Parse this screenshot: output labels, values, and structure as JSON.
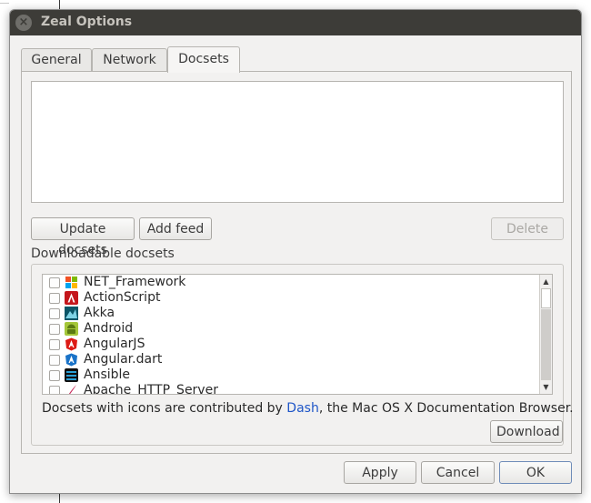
{
  "window": {
    "title": "Zeal Options",
    "close_glyph": "×"
  },
  "tabs": [
    {
      "label": "General",
      "active": false
    },
    {
      "label": "Network",
      "active": false
    },
    {
      "label": "Docsets",
      "active": true
    }
  ],
  "buttons": {
    "update": "Update docsets",
    "add_feed": "Add feed",
    "delete": "Delete",
    "download": "Download",
    "apply": "Apply",
    "cancel": "Cancel",
    "ok": "OK"
  },
  "downloadable": {
    "heading": "Downloadable docsets",
    "items": [
      {
        "label": "NET_Framework",
        "checked": false,
        "icon": "dotnet-icon"
      },
      {
        "label": "ActionScript",
        "checked": false,
        "icon": "actionscript-icon"
      },
      {
        "label": "Akka",
        "checked": false,
        "icon": "akka-icon"
      },
      {
        "label": "Android",
        "checked": false,
        "icon": "android-icon"
      },
      {
        "label": "AngularJS",
        "checked": false,
        "icon": "angularjs-icon"
      },
      {
        "label": "Angular.dart",
        "checked": false,
        "icon": "angulardart-icon"
      },
      {
        "label": "Ansible",
        "checked": false,
        "icon": "ansible-icon"
      },
      {
        "label": "Apache_HTTP_Server",
        "checked": false,
        "icon": "apache-icon"
      }
    ]
  },
  "credit": {
    "prefix": "Docsets with icons are contributed by ",
    "link": "Dash",
    "suffix": ", the Mac OS X Documentation Browser."
  },
  "colors": {
    "titlebar": "#3d3c38",
    "link": "#1f56c8",
    "window_bg": "#f2f1f0"
  }
}
